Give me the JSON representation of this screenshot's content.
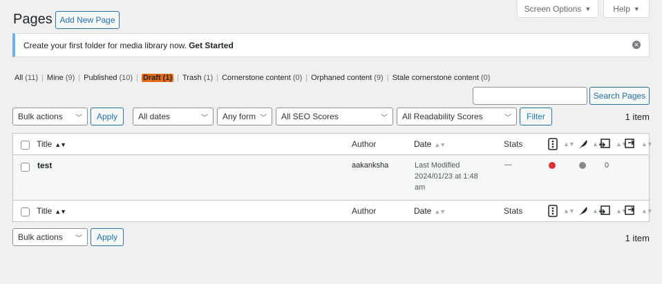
{
  "header": {
    "screen_options": "Screen Options",
    "help": "Help",
    "title": "Pages",
    "add_new": "Add New Page"
  },
  "notice": {
    "text": "Create your first folder for media library now.",
    "link": "Get Started"
  },
  "views": [
    {
      "label": "All",
      "count": "(11)"
    },
    {
      "label": "Mine",
      "count": "(9)"
    },
    {
      "label": "Published",
      "count": "(10)"
    },
    {
      "label": "Draft",
      "count": "(1)",
      "current": true
    },
    {
      "label": "Trash",
      "count": "(1)"
    },
    {
      "label": "Cornerstone content",
      "count": "(0)"
    },
    {
      "label": "Orphaned content",
      "count": "(9)"
    },
    {
      "label": "Stale cornerstone content",
      "count": "(0)"
    }
  ],
  "search": {
    "button": "Search Pages",
    "value": ""
  },
  "filters": {
    "bulk_actions": "Bulk actions",
    "apply": "Apply",
    "dates": "All dates",
    "form": "Any form",
    "seo": "All SEO Scores",
    "readability": "All Readability Scores",
    "filter": "Filter",
    "count": "1 item"
  },
  "table": {
    "columns": {
      "title": "Title",
      "author": "Author",
      "date": "Date",
      "stats": "Stats"
    },
    "rows": [
      {
        "title": "test",
        "author": "aakanksha",
        "date_line1": "Last Modified",
        "date_line2": "2024/01/23 at 1:48",
        "date_line3": "am",
        "stats": "—",
        "seo_status_color": "#dc3232",
        "readability_status_color": "#888888",
        "links_count": "0"
      }
    ]
  },
  "bottom": {
    "bulk_actions": "Bulk actions",
    "apply": "Apply",
    "count": "1 item"
  }
}
